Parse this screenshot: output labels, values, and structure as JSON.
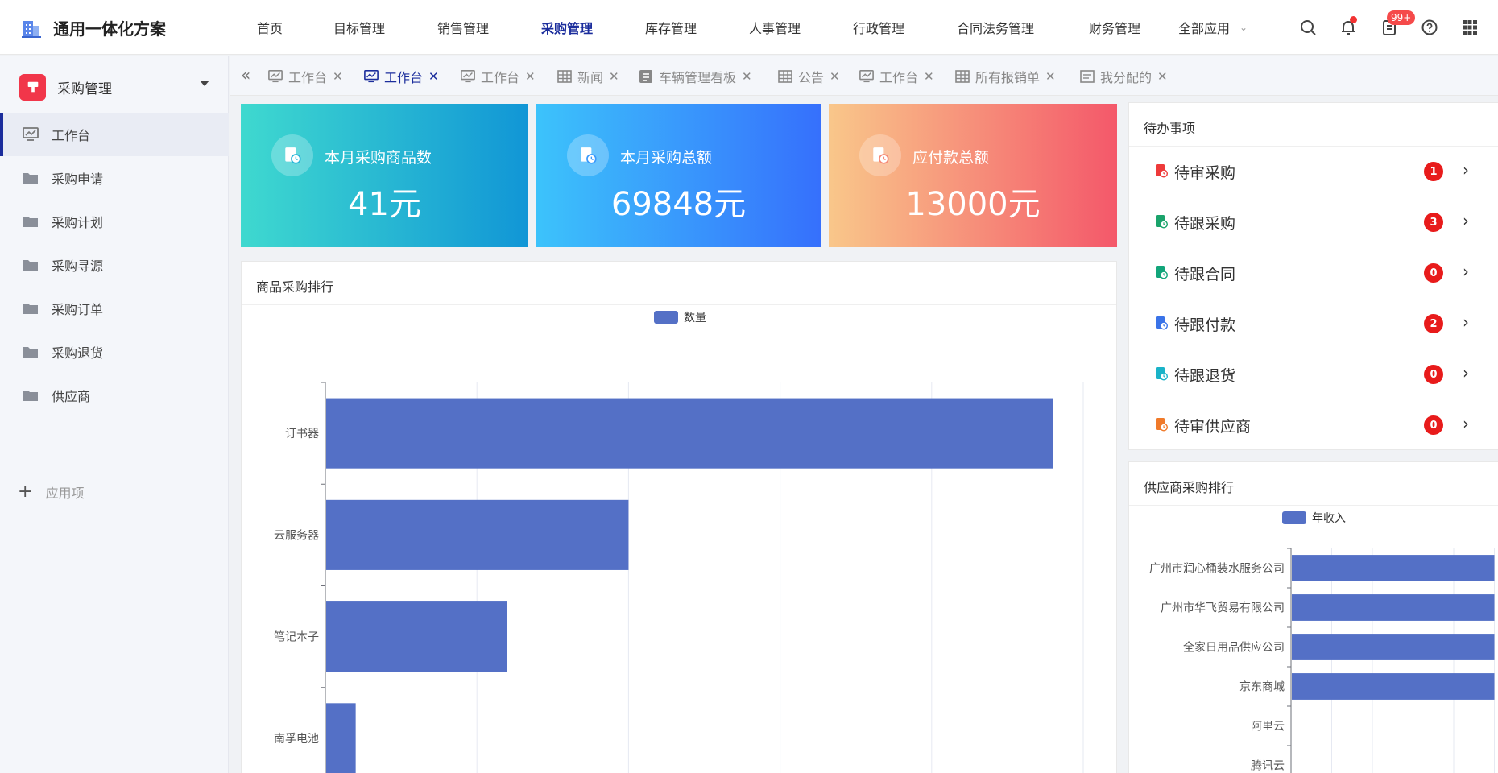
{
  "header": {
    "brand_title": "通用一体化方案",
    "nav": [
      "首页",
      "目标管理",
      "销售管理",
      "采购管理",
      "库存管理",
      "人事管理",
      "行政管理",
      "合同法务管理",
      "财务管理"
    ],
    "nav_active_index": 3,
    "all_apps_label": "全部应用",
    "notification_badge": "99+"
  },
  "sidebar": {
    "app_title": "采购管理",
    "items": [
      "工作台",
      "采购申请",
      "采购计划",
      "采购寻源",
      "采购订单",
      "采购退货",
      "供应商"
    ],
    "active_index": 0,
    "add_label": "应用项"
  },
  "tabs": [
    {
      "label": "工作台",
      "icon": "dashboard-icon"
    },
    {
      "label": "工作台",
      "icon": "dashboard-icon",
      "active": true
    },
    {
      "label": "工作台",
      "icon": "dashboard-icon"
    },
    {
      "label": "新闻",
      "icon": "table-icon"
    },
    {
      "label": "车辆管理看板",
      "icon": "board-icon"
    },
    {
      "label": "公告",
      "icon": "table-icon"
    },
    {
      "label": "工作台",
      "icon": "dashboard-icon"
    },
    {
      "label": "所有报销单",
      "icon": "table-icon"
    },
    {
      "label": "我分配的",
      "icon": "form-icon"
    }
  ],
  "stats": [
    {
      "title": "本月采购商品数",
      "value": "41元"
    },
    {
      "title": "本月采购总额",
      "value": "69848元"
    },
    {
      "title": "应付款总额",
      "value": "13000元"
    }
  ],
  "colors": {
    "accent": "#1b2d9c",
    "bar": "#5470c6",
    "badge_red": "#e81b1b",
    "card1": [
      "#3fd9cf",
      "#1196d6"
    ],
    "card2": [
      "#3cc3fb",
      "#3670fc"
    ],
    "card3": [
      "#f9c78a",
      "#f4586a"
    ]
  },
  "product_panel": {
    "title": "商品采购排行"
  },
  "todo": {
    "title": "待办事项",
    "items": [
      {
        "label": "待审采购",
        "count": "1",
        "color": "#ee3a3a"
      },
      {
        "label": "待跟采购",
        "count": "3",
        "color": "#1aa36b"
      },
      {
        "label": "待跟合同",
        "count": "0",
        "color": "#12a57a"
      },
      {
        "label": "待跟付款",
        "count": "2",
        "color": "#3a73e8"
      },
      {
        "label": "待跟退货",
        "count": "0",
        "color": "#1ab3c8"
      },
      {
        "label": "待审供应商",
        "count": "0",
        "color": "#f07a2a"
      }
    ]
  },
  "supplier_panel": {
    "title": "供应商采购排行"
  },
  "chart_data": [
    {
      "type": "bar",
      "orientation": "horizontal",
      "legend": [
        "数量"
      ],
      "legend_position": "top-center",
      "categories": [
        "订书器",
        "云服务器",
        "笔记本子",
        "南孚电池"
      ],
      "series": [
        {
          "name": "数量",
          "values": [
            48,
            20,
            12,
            2
          ]
        }
      ],
      "xlim": [
        0,
        50
      ],
      "grid": true
    },
    {
      "type": "bar",
      "orientation": "horizontal",
      "legend": [
        "年收入"
      ],
      "legend_position": "top-center",
      "categories": [
        "广州市润心桶装水服务公司",
        "广州市华飞贸易有限公司",
        "全家日用品供应公司",
        "京东商城",
        "阿里云",
        "腾讯云"
      ],
      "series": [
        {
          "name": "年收入",
          "values": [
            5,
            5,
            5,
            5,
            0,
            0
          ]
        }
      ],
      "xlim": [
        0,
        6
      ],
      "grid": true
    }
  ]
}
